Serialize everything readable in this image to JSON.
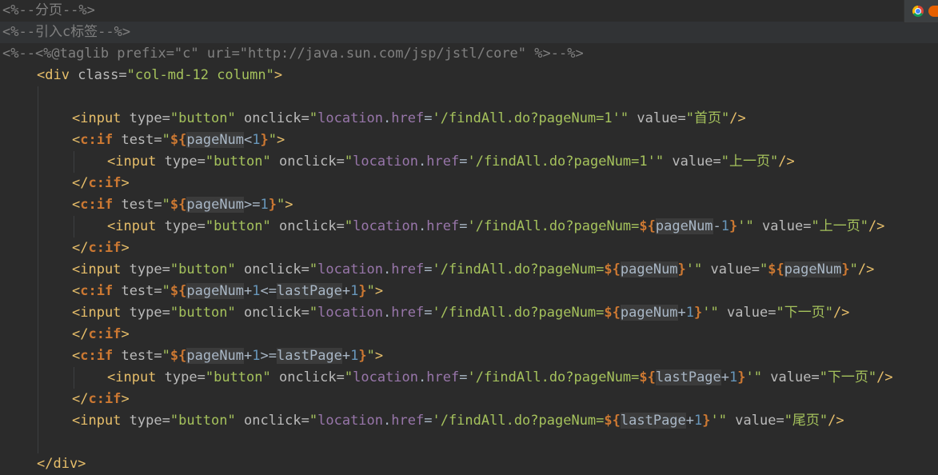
{
  "editor": {
    "lines": [
      "<%--分页--%>",
      "<%--引入c标签--%>",
      "<%--<%@taglib prefix=\"c\" uri=\"http://java.sun.com/jsp/jstl/core\" %>--%>",
      "<div class=\"col-md-12 column\">",
      "",
      "<input type=\"button\" onclick=\"location.href='/findAll.do?pageNum=1'\" value=\"首页\"/>",
      "<c:if test=\"${pageNum<1}\">",
      "<input type=\"button\" onclick=\"location.href='/findAll.do?pageNum=1'\" value=\"上一页\"/>",
      "</c:if>",
      "<c:if test=\"${pageNum>=1}\">",
      "<input type=\"button\" onclick=\"location.href='/findAll.do?pageNum=${pageNum-1}'\" value=\"上一页\"/>",
      "</c:if>",
      "<input type=\"button\" onclick=\"location.href='/findAll.do?pageNum=${pageNum}'\" value=\"${pageNum}\"/>",
      "<c:if test=\"${pageNum+1<=lastPage+1}\">",
      "<input type=\"button\" onclick=\"location.href='/findAll.do?pageNum=${pageNum+1}'\" value=\"下一页\"/>",
      "</c:if>",
      "<c:if test=\"${pageNum+1>=lastPage+1}\">",
      "<input type=\"button\" onclick=\"location.href='/findAll.do?pageNum=${lastPage+1}'\" value=\"下一页\"/>",
      "</c:if>",
      "<input type=\"button\" onclick=\"location.href='/findAll.do?pageNum=${lastPage+1}'\" value=\"尾页\"/>",
      "",
      "</div>"
    ]
  },
  "browser_icons": [
    "chrome-icon",
    "firefox-icon"
  ]
}
